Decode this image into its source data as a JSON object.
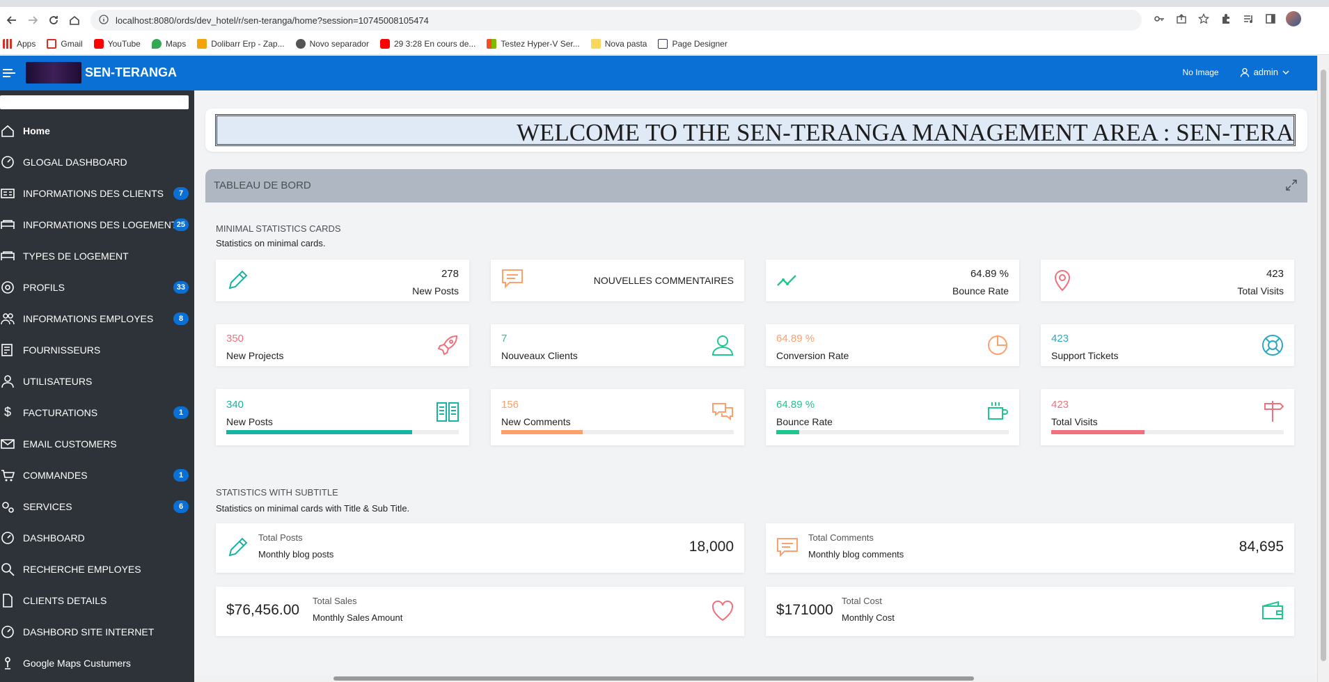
{
  "browser": {
    "url": "localhost:8080/ords/dev_hotel/r/sen-teranga/home?session=10745008105474",
    "bookmarks": [
      "Apps",
      "Gmail",
      "YouTube",
      "Maps",
      "Dolibarr Erp - Zap...",
      "Novo separador",
      "29 3:28 En cours de...",
      "Testez Hyper-V Ser...",
      "Nova pasta",
      "Page Designer"
    ]
  },
  "header": {
    "app_title": "SEN-TERANGA",
    "no_image": "No Image",
    "user": "admin"
  },
  "sidebar": {
    "items": [
      {
        "label": "Home",
        "badge": ""
      },
      {
        "label": "GLOGAL DASHBOARD",
        "badge": ""
      },
      {
        "label": "INFORMATIONS DES CLIENTS",
        "badge": "7"
      },
      {
        "label": "INFORMATIONS DES LOGEMENTS",
        "badge": "25"
      },
      {
        "label": "TYPES DE LOGEMENT",
        "badge": ""
      },
      {
        "label": "PROFILS",
        "badge": "33"
      },
      {
        "label": "INFORMATIONS EMPLOYES",
        "badge": "8"
      },
      {
        "label": "FOURNISSEURS",
        "badge": ""
      },
      {
        "label": "UTILISATEURS",
        "badge": ""
      },
      {
        "label": "FACTURATIONS",
        "badge": "1"
      },
      {
        "label": "EMAIL CUSTOMERS",
        "badge": ""
      },
      {
        "label": "COMMANDES",
        "badge": "1"
      },
      {
        "label": "SERVICES",
        "badge": "6"
      },
      {
        "label": "DASHBOARD",
        "badge": ""
      },
      {
        "label": "RECHERCHE EMPLOYES",
        "badge": ""
      },
      {
        "label": "CLIENTS DETAILS",
        "badge": ""
      },
      {
        "label": "DASHBORD SITE INTERNET",
        "badge": ""
      },
      {
        "label": "Google Maps Custumers",
        "badge": ""
      }
    ]
  },
  "welcome": "WELCOME TO THE SEN-TERANGA MANAGEMENT AREA : SEN-TERA",
  "region_title": "TABLEAU DE BORD",
  "minimal": {
    "title": "MINIMAL STATISTICS CARDS",
    "subtitle": "Statistics on minimal cards.",
    "row1": [
      {
        "value": "278",
        "label": "New Posts"
      },
      {
        "value": "",
        "label": "NOUVELLES COMMENTAIRES"
      },
      {
        "value": "64.89 %",
        "label": "Bounce Rate"
      },
      {
        "value": "423",
        "label": "Total Visits"
      }
    ],
    "row2": [
      {
        "value": "350",
        "label": "New Projects"
      },
      {
        "value": "7",
        "label": "Nouveaux Clients"
      },
      {
        "value": "64.89 %",
        "label": "Conversion Rate"
      },
      {
        "value": "423",
        "label": "Support Tickets"
      }
    ],
    "row3": [
      {
        "value": "340",
        "label": "New Posts",
        "progress": 0.8
      },
      {
        "value": "156",
        "label": "New Comments",
        "progress": 0.35
      },
      {
        "value": "64.89 %",
        "label": "Bounce Rate",
        "progress": 0.1
      },
      {
        "value": "423",
        "label": "Total Visits",
        "progress": 0.4
      }
    ]
  },
  "subtitle_stats": {
    "title": "STATISTICS WITH SUBTITLE",
    "subtitle": "Statistics on minimal cards with Title & Sub Title.",
    "cards": [
      {
        "title": "Total Posts",
        "sub": "Monthly blog posts",
        "value": "18,000"
      },
      {
        "title": "Total Comments",
        "sub": "Monthly blog comments",
        "value": "84,695"
      },
      {
        "title": "Total Sales",
        "sub": "Monthly Sales Amount",
        "value": "$76,456.00"
      },
      {
        "title": "Total Cost",
        "sub": "Monthly Cost",
        "value": "$171000"
      }
    ]
  },
  "colors": {
    "teal": "#17b3a3",
    "orange": "#ff9f6b",
    "red": "#f0707e",
    "green": "#1ec78e",
    "cyan": "#2aa8c4",
    "brand": "#0a70d6"
  }
}
